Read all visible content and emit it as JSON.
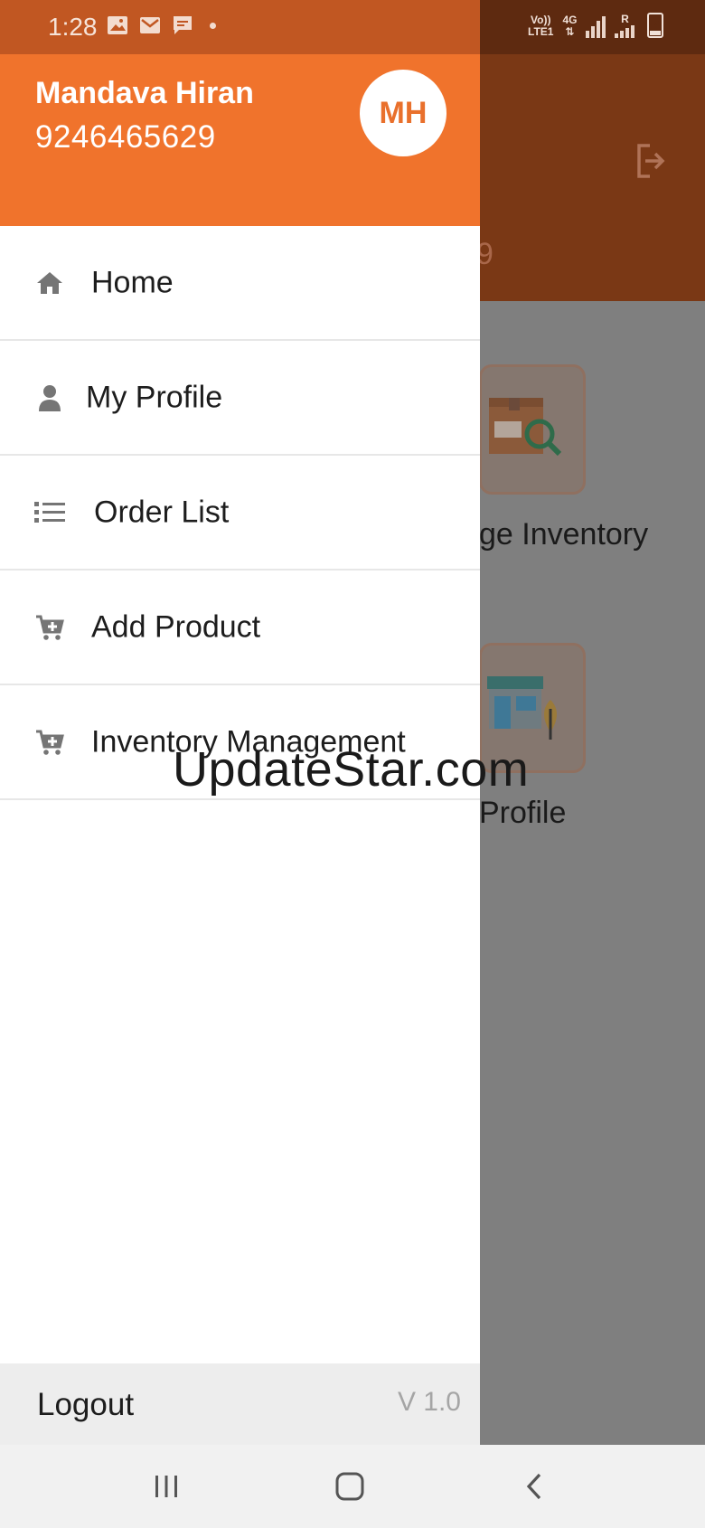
{
  "status_bar": {
    "time": "1:28",
    "network": {
      "line1": "Vo))",
      "line2": "LTE1",
      "gen": "4G",
      "roaming": "R"
    },
    "battery_level": "7",
    "icons": [
      "image-icon",
      "mail-icon",
      "chat-icon",
      "dot-icon",
      "signal-icon",
      "battery-icon"
    ]
  },
  "drawer": {
    "user": {
      "name": "Mandava Hiran",
      "phone": "9246465629",
      "initials": "MH"
    },
    "items": [
      {
        "label": "Home",
        "icon": "home-icon"
      },
      {
        "label": "My Profile",
        "icon": "person-icon"
      },
      {
        "label": "Order List",
        "icon": "list-icon"
      },
      {
        "label": "Add Product",
        "icon": "cart-plus-icon"
      },
      {
        "label": "Inventory Management",
        "icon": "cart-plus-icon"
      }
    ],
    "footer": {
      "logout": "Logout",
      "version": "V 1.0"
    }
  },
  "background": {
    "header_digit": "9",
    "tiles": [
      {
        "label": "ge Inventory",
        "icon": "box-search-icon"
      },
      {
        "label": "Profile",
        "icon": "store-icon"
      }
    ]
  },
  "watermark": "UpdateStar.com",
  "colors": {
    "accent": "#f0732c",
    "header_dim": "#7a3815",
    "status_left": "#c15722",
    "overlay": "#808080",
    "icon_gray": "#757575"
  }
}
